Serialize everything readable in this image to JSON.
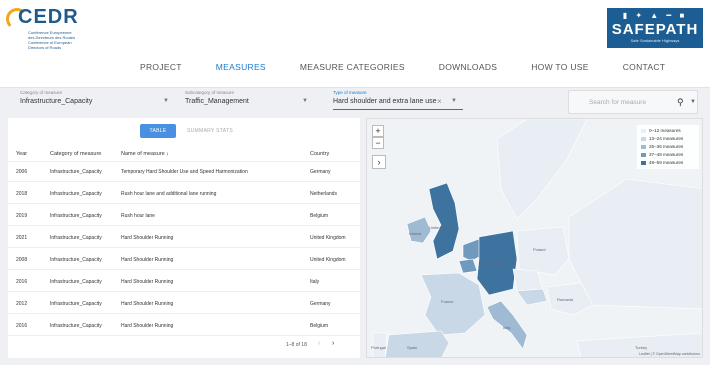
{
  "header": {
    "logo_text": "CEDR",
    "logo_lines": [
      "Conférence Européenne",
      "des Directeurs des Routes",
      "Conference of European",
      "Directors of Roads"
    ],
    "brand_name": "SAFEPATH",
    "brand_tagline": "Safe Sustainable Highways",
    "nav": [
      "PROJECT",
      "MEASURES",
      "MEASURE CATEGORIES",
      "DOWNLOADS",
      "HOW TO USE",
      "CONTACT"
    ],
    "active_nav": "MEASURES"
  },
  "filters": {
    "category": {
      "label": "Category of measure",
      "value": "Infrastructure_Capacity"
    },
    "subcategory": {
      "label": "Subcategory of measure",
      "value": "Traffic_Management"
    },
    "type": {
      "label": "Type of measure",
      "value": "Hard shoulder and extra lane use"
    },
    "search_placeholder": "Search for measure"
  },
  "table": {
    "tabs": [
      "TABLE",
      "SUMMARY STATS"
    ],
    "columns": [
      "Year",
      "Category of measure",
      "Name of measure ↓",
      "Country"
    ],
    "rows": [
      [
        "2006",
        "Infrastructure_Capacity",
        "Temporary Hard Shoulder Use and Speed Harmonization",
        "Germany"
      ],
      [
        "2018",
        "Infrastructure_Capacity",
        "Rush hour lane and additional lane running",
        "Netherlands"
      ],
      [
        "2019",
        "Infrastructure_Capacity",
        "Rush hour lane",
        "Belgium"
      ],
      [
        "2021",
        "Infrastructure_Capacity",
        "Hard Shoulder Running",
        "United Kingdom"
      ],
      [
        "2008",
        "Infrastructure_Capacity",
        "Hard Shoulder Running",
        "United Kingdom"
      ],
      [
        "2016",
        "Infrastructure_Capacity",
        "Hard Shoulder Running",
        "Italy"
      ],
      [
        "2012",
        "Infrastructure_Capacity",
        "Hard Shoulder Running",
        "Germany"
      ],
      [
        "2016",
        "Infrastructure_Capacity",
        "Hard Shoulder Running",
        "Belgium"
      ]
    ],
    "pagination": "1–8 of 18"
  },
  "map": {
    "legend": [
      {
        "label": "0–12 measures",
        "color": "#e8eef4"
      },
      {
        "label": "13–24 measures",
        "color": "#c9d8e6"
      },
      {
        "label": "25–36 measures",
        "color": "#9fbbd4"
      },
      {
        "label": "37–48 measures",
        "color": "#6f99bd"
      },
      {
        "label": "49–59 measures",
        "color": "#3f739f"
      }
    ],
    "country_labels": [
      "Ireland",
      "United Kingdom",
      "Germany",
      "Poland",
      "France",
      "Spain",
      "Italy",
      "Romania",
      "Portugal",
      "Turkey"
    ],
    "attribution": "Leaflet | © OpenStreetMap contributors"
  }
}
